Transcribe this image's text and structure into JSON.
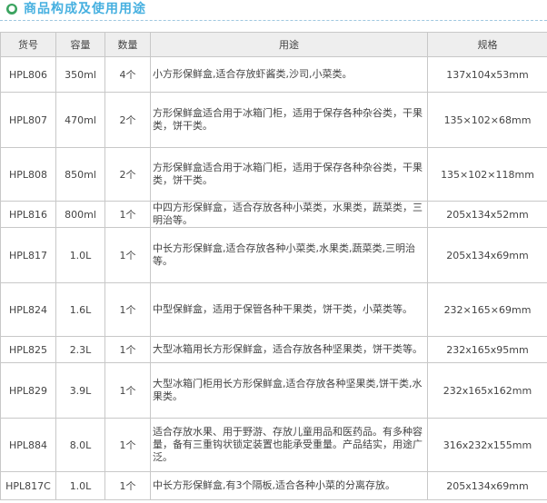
{
  "header": {
    "bullet": "●",
    "title": "商品构成及使用用途"
  },
  "table": {
    "columns": [
      "货号",
      "容量",
      "数量",
      "用途",
      "规格"
    ],
    "rows": [
      [
        "HPL806",
        "350ml",
        "4个",
        "小方形保鲜盒,适合存放虾酱类,沙司,小菜类。",
        "137x104x53mm"
      ],
      [
        "HPL807",
        "470ml",
        "2个",
        "方形保鲜盒适合用于冰箱门柜，适用于保存各种杂谷类，干果类，饼干类。",
        "135×102×68mm"
      ],
      [
        "HPL808",
        "850ml",
        "2个",
        "方形保鲜盒适合用于冰箱门柜，适用于保存各种杂谷类，干果类，饼干类。",
        "135×102×118mm"
      ],
      [
        "HPL816",
        "800ml",
        "1个",
        "中四方形保鲜盒，适合存放各种小菜类，水果类，蔬菜类，三明治等。",
        "205x134x52mm"
      ],
      [
        "HPL817",
        "1.0L",
        "1个",
        "中长方形保鲜盒,适合存放各种小菜类,水果类,蔬菜类,三明治等。",
        "205x134x69mm"
      ],
      [
        "HPL824",
        "1.6L",
        "1个",
        "中型保鲜盒，适用于保管各种干果类，饼干类，小菜类等。",
        "232×165×69mm"
      ],
      [
        "HPL825",
        "2.3L",
        "1个",
        "大型冰箱用长方形保鲜盒，适合存放各种坚果类，饼干类等。",
        "232x165x95mm"
      ],
      [
        "HPL829",
        "3.9L",
        "1个",
        "大型冰箱门柜用长方形保鲜盒,适合存放各种坚果类,饼干类,水果类。",
        "232x165x162mm"
      ],
      [
        "HPL884",
        "8.0L",
        "1个",
        "适合存放水果、用于野游、存放儿童用品和医药品。有多种容量，备有三重钩状锁定装置也能承受重量。产品结实，用途广泛。",
        "316x232x155mm"
      ],
      [
        "HPL817C",
        "1.0L",
        "1个",
        "中长方形保鲜盒,有3个隔板,适合各种小菜的分离存放。",
        "205x134x69mm"
      ]
    ]
  }
}
